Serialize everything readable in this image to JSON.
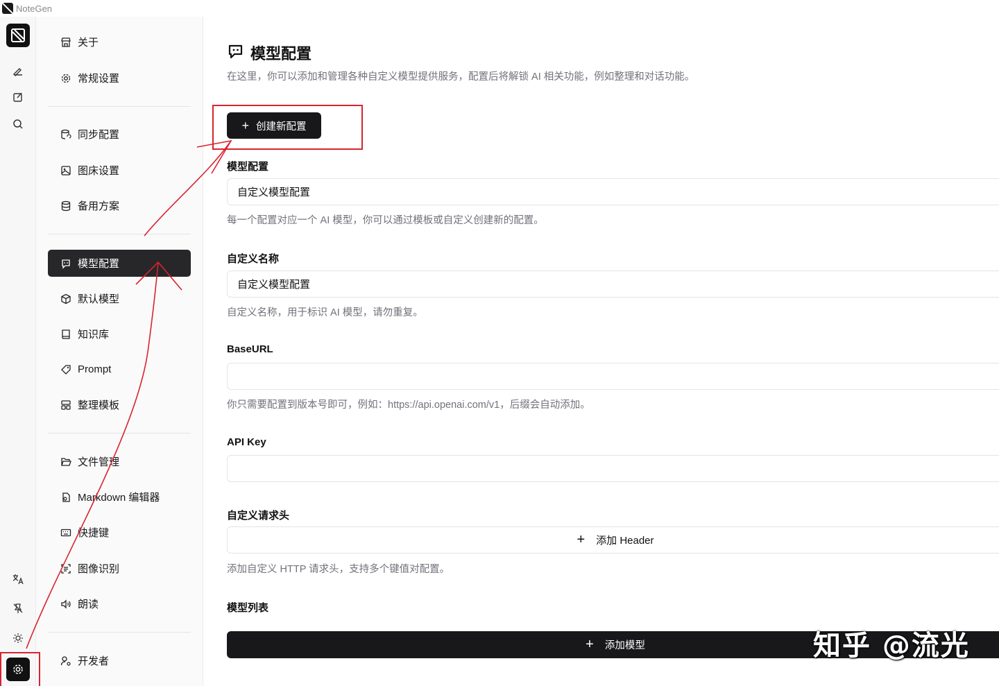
{
  "app": {
    "title": "NoteGen"
  },
  "rail": {
    "items": [
      {
        "icon": "pen-icon"
      },
      {
        "icon": "edit-icon"
      },
      {
        "icon": "search-icon"
      },
      {
        "icon": "translate-icon"
      },
      {
        "icon": "pin-off-icon"
      },
      {
        "icon": "sun-icon"
      },
      {
        "icon": "gear-icon"
      }
    ]
  },
  "sidebar": {
    "items": [
      {
        "label": "关于",
        "icon": "store-icon"
      },
      {
        "label": "常规设置",
        "icon": "gear-icon"
      },
      {
        "label": "同步配置",
        "icon": "database-sync-icon"
      },
      {
        "label": "图床设置",
        "icon": "image-icon"
      },
      {
        "label": "备用方案",
        "icon": "database-icon"
      },
      {
        "label": "模型配置",
        "icon": "bot-message-icon"
      },
      {
        "label": "默认模型",
        "icon": "box-icon"
      },
      {
        "label": "知识库",
        "icon": "book-icon"
      },
      {
        "label": "Prompt",
        "icon": "tag-icon"
      },
      {
        "label": "整理模板",
        "icon": "layout-icon"
      },
      {
        "label": "文件管理",
        "icon": "folder-open-icon"
      },
      {
        "label": "Markdown 编辑器",
        "icon": "file-code-icon"
      },
      {
        "label": "快捷键",
        "icon": "keyboard-icon"
      },
      {
        "label": "图像识别",
        "icon": "scan-text-icon"
      },
      {
        "label": "朗读",
        "icon": "volume-icon"
      },
      {
        "label": "开发者",
        "icon": "user-cog-icon"
      }
    ],
    "active_index": 5
  },
  "main": {
    "title": "模型配置",
    "description": "在这里，你可以添加和管理各种自定义模型提供服务，配置后将解锁 AI 相关功能，例如整理和对话功能。",
    "create_button": "创建新配置",
    "model_config": {
      "label": "模型配置",
      "value": "自定义模型配置",
      "help": "每一个配置对应一个 AI 模型，你可以通过模板或自定义创建新的配置。"
    },
    "custom_name": {
      "label": "自定义名称",
      "value": "自定义模型配置",
      "help": "自定义名称，用于标识 AI 模型，请勿重复。"
    },
    "base_url": {
      "label": "BaseURL",
      "value": "",
      "help": "你只需要配置到版本号即可，例如：https://api.openai.com/v1，后缀会自动添加。"
    },
    "api_key": {
      "label": "API Key",
      "value": ""
    },
    "custom_headers": {
      "label": "自定义请求头",
      "button": "添加 Header",
      "help": "添加自定义 HTTP 请求头，支持多个键值对配置。"
    },
    "model_list": {
      "label": "模型列表",
      "button": "添加模型"
    }
  },
  "watermark": "知乎 @流光",
  "colors": {
    "accent": "#18181b",
    "annotation": "#d9232e"
  }
}
